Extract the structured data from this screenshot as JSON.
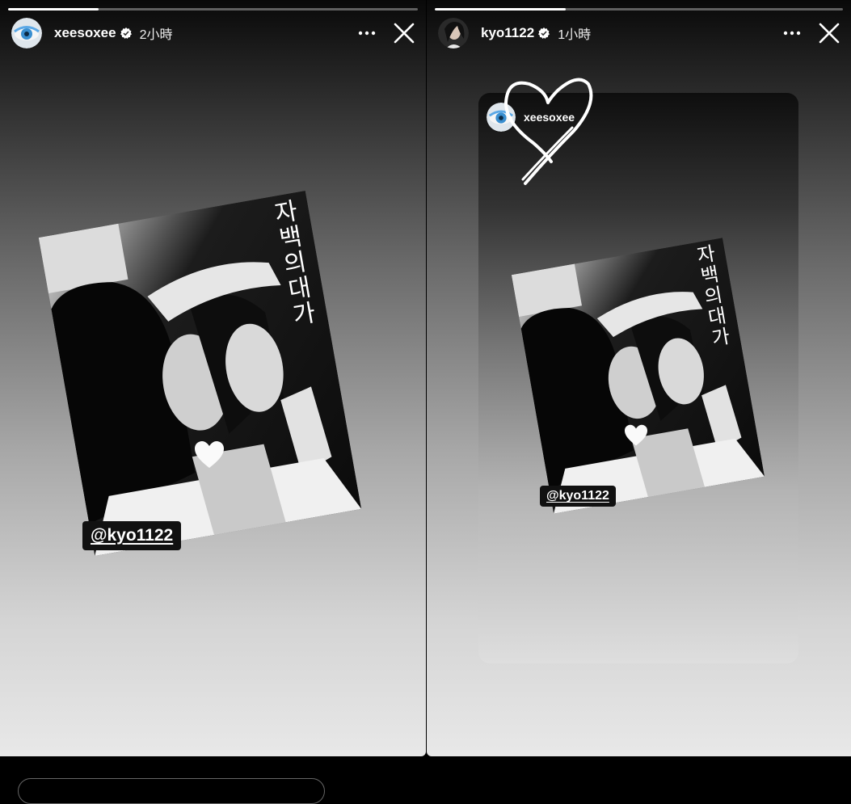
{
  "stories": [
    {
      "username": "xeesoxee",
      "time": "2小時",
      "progress": 0.22,
      "title_vertical": "자백의대가",
      "mention": "@kyo1122",
      "avatar_icon": "blue-eye-avatar"
    },
    {
      "username": "kyo1122",
      "time": "1小時",
      "progress": 0.32,
      "title_vertical": "자백의대가",
      "mention": "@kyo1122",
      "avatar_icon": "portrait-avatar",
      "reshared_from": "xeesoxee"
    }
  ],
  "colors": {
    "accent_text": "#ffffff",
    "tag_bg": "#111111"
  }
}
